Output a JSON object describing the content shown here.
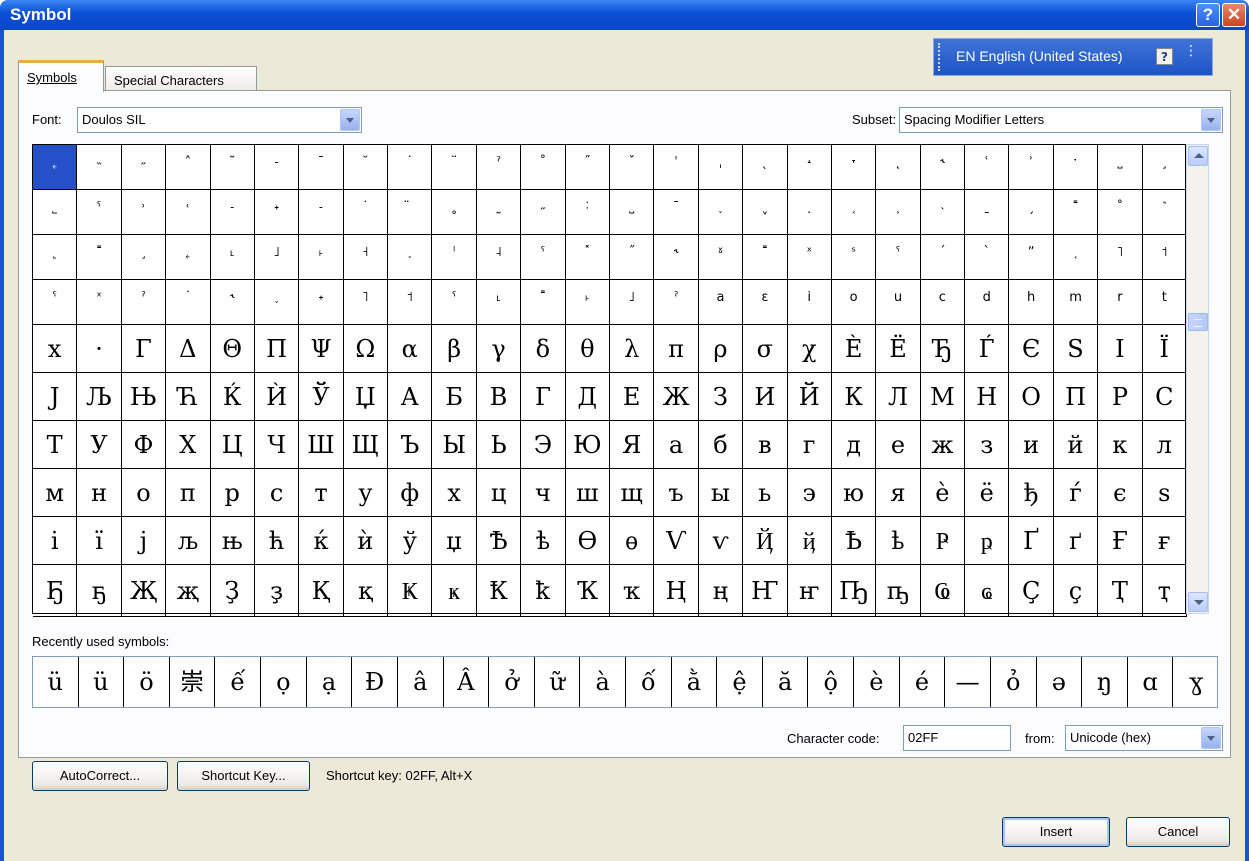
{
  "window": {
    "title": "Symbol",
    "help_button": "?",
    "close_button": "✕"
  },
  "language_bar": {
    "label": "EN English (United States)",
    "help_icon": "?",
    "options_icon": "⋮"
  },
  "tabs": [
    {
      "label": "Symbols",
      "active": true
    },
    {
      "label": "Special Characters",
      "active": false
    }
  ],
  "font": {
    "label": "Font:",
    "value": "Doulos SIL"
  },
  "subset": {
    "label": "Subset:",
    "value": "Spacing Modifier Letters"
  },
  "symbol_rows": [
    [
      "˿",
      "˵",
      "˶",
      "˄",
      "˜",
      "˗",
      "¯",
      "˘",
      "˙",
      "¨",
      "ˀ",
      "˚",
      "˝",
      "ˇ",
      "ˈ",
      "ˌ",
      "ˎ",
      "˔",
      "˕",
      "˛",
      "˞",
      "ʿ",
      "ʾ",
      "ˑ",
      "˽",
      "˼"
    ],
    [
      "˾",
      "ˁ",
      "˒",
      "˓",
      "˗",
      "˖",
      "˗",
      "˙",
      "̈",
      "˳",
      "˷",
      "˶",
      "˸",
      "˽",
      "ˉ",
      "˯",
      "ˬ",
      "˰",
      "˱",
      "˲",
      "˴",
      "ˍ",
      "ˏ",
      "˭",
      "˚",
      "˺"
    ],
    [
      "˻",
      "˭",
      "˼",
      "˿",
      "˪",
      "˩",
      "˫",
      "˧",
      "˯",
      "ˡ",
      "˨",
      "ˤ",
      "˟",
      "˝",
      "˞",
      "ˠ",
      "˭",
      "ˣ",
      "ˢ",
      "ˤ",
      "ˊ",
      "ˋ",
      "ˮ",
      "˱",
      "˥",
      "˦"
    ],
    [
      "ˤ",
      "ˣ",
      "ˀ",
      "˙",
      "˞",
      "˯",
      "˖",
      "˥",
      "˦",
      "ˁ",
      "˪",
      "˭",
      "˫",
      "˩",
      "ˀ",
      "a",
      "ɛ",
      "i",
      "o",
      "u",
      "c",
      "d",
      "h",
      "m",
      "r",
      "t"
    ],
    [
      "x",
      "·",
      "Γ",
      "Δ",
      "Θ",
      "Π",
      "Ψ",
      "Ω",
      "α",
      "β",
      "γ",
      "δ",
      "θ",
      "λ",
      "π",
      "ρ",
      "σ",
      "χ",
      "È",
      "Ë",
      "Ђ",
      "Ѓ",
      "Є",
      "S",
      "I",
      "Ï"
    ],
    [
      "J",
      "Љ",
      "Њ",
      "Ћ",
      "Ќ",
      "Ѝ",
      "Ў",
      "Џ",
      "А",
      "Б",
      "В",
      "Г",
      "Д",
      "Е",
      "Ж",
      "З",
      "И",
      "Й",
      "К",
      "Л",
      "М",
      "Н",
      "О",
      "П",
      "Р",
      "С"
    ],
    [
      "Т",
      "У",
      "Ф",
      "Х",
      "Ц",
      "Ч",
      "Ш",
      "Щ",
      "Ъ",
      "Ы",
      "Ь",
      "Э",
      "Ю",
      "Я",
      "а",
      "б",
      "в",
      "г",
      "д",
      "е",
      "ж",
      "з",
      "и",
      "й",
      "к",
      "л"
    ],
    [
      "м",
      "н",
      "о",
      "п",
      "р",
      "с",
      "т",
      "у",
      "ф",
      "х",
      "ц",
      "ч",
      "ш",
      "щ",
      "ъ",
      "ы",
      "ь",
      "э",
      "ю",
      "я",
      "ѐ",
      "ё",
      "ђ",
      "ѓ",
      "є",
      "s"
    ],
    [
      "і",
      "ї",
      "j",
      "љ",
      "њ",
      "ћ",
      "ќ",
      "ѝ",
      "ў",
      "џ",
      "Ѣ",
      "ѣ",
      "Ѳ",
      "ѳ",
      "Ѵ",
      "ѵ",
      "Ҋ",
      "ҋ",
      "Ҍ",
      "ҍ",
      "Ҏ",
      "ҏ",
      "Ґ",
      "ґ",
      "Ғ",
      "ғ"
    ],
    [
      "Ҕ",
      "ҕ",
      "Җ",
      "җ",
      "Ҙ",
      "ҙ",
      "Қ",
      "қ",
      "Ҝ",
      "ҝ",
      "Ҟ",
      "ҟ",
      "Ҡ",
      "ҡ",
      "Ң",
      "ң",
      "Ҥ",
      "ҥ",
      "Ҧ",
      "ҧ",
      "Ҩ",
      "ҩ",
      "Ҫ",
      "ҫ",
      "Ҭ",
      "ҭ"
    ]
  ],
  "recent": {
    "label": "Recently used symbols:",
    "symbols": [
      "ü",
      "ü",
      "ö",
      "崇",
      "ế",
      "ọ",
      "ạ",
      "Đ",
      "â",
      "Â",
      "ở",
      "ữ",
      "à",
      "ố",
      "ằ",
      "ệ",
      "ă",
      "ộ",
      "è",
      "é",
      "—",
      "ỏ",
      "ə",
      "ŋ",
      "ɑ",
      "ɣ"
    ]
  },
  "character_code": {
    "label": "Character code:",
    "value": "02FF"
  },
  "from": {
    "label": "from:",
    "value": "Unicode (hex)"
  },
  "buttons": {
    "autocorrect": "AutoCorrect...",
    "shortcut_key": "Shortcut Key...",
    "insert": "Insert",
    "cancel": "Cancel"
  },
  "shortcut_text": "Shortcut key: 02FF, Alt+X"
}
